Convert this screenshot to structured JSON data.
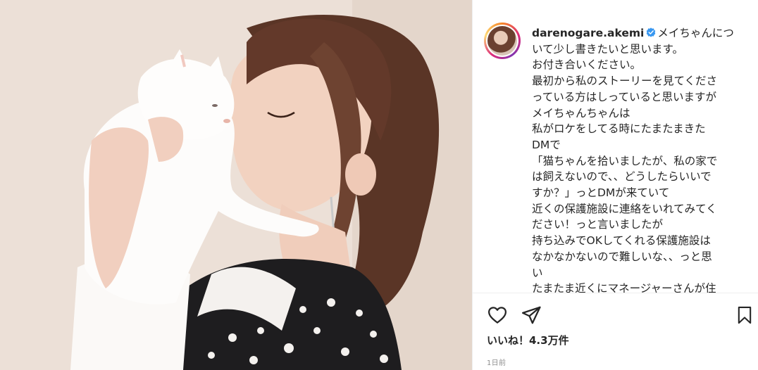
{
  "post": {
    "username": "darenogare.akemi",
    "caption_lines": [
      "メイちゃんにつ",
      "いて少し書きたいと思います。",
      "お付き合いください。",
      "最初から私のストーリーを見てくださ",
      "っている方はしっていると思いますが",
      "メイちゃんちゃんは",
      "私がロケをしてる時にたまたまきた",
      "DMで",
      "「猫ちゃんを拾いましたが、私の家で",
      "は飼えないので、、どうしたらいいで",
      "すか？」っとDMが来ていて",
      "近くの保護施設に連絡をいれてみてく",
      "ださい！っと言いましたが",
      "持ち込みでOKしてくれる保護施設は",
      "なかなかないので難しいな、、っと思",
      "い",
      "たまたま近くにマネージャーさんが住"
    ],
    "likes": "いいね！4.3万件",
    "time": "1日前"
  },
  "icons": {
    "like": "heart-icon",
    "share": "paper-plane-icon",
    "save": "bookmark-icon",
    "verified": "verified-badge-icon"
  },
  "colors": {
    "verified": "#3897f0",
    "text": "#262626",
    "muted": "#8e8e8e"
  }
}
